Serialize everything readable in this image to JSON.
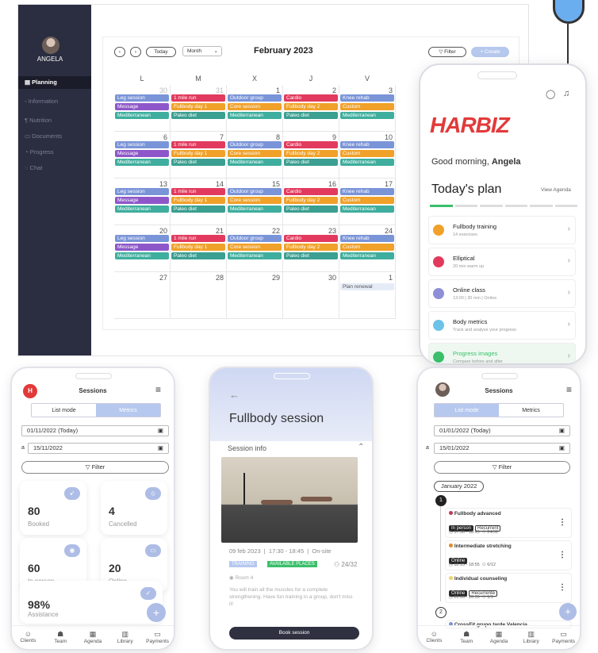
{
  "desktop": {
    "user": "ANGELA",
    "nav": [
      "Planning",
      "Information",
      "Nutrition",
      "Documents",
      "Progress",
      "Chat"
    ],
    "today": "Today",
    "view": "Month",
    "month": "February 2023",
    "filter": "Filter",
    "create": "+ Create",
    "days": [
      "L",
      "M",
      "X",
      "J",
      "V"
    ],
    "weeks": [
      {
        "dates": [
          "30",
          "31",
          "1",
          "2",
          "3"
        ],
        "muted": [
          true,
          true,
          false,
          false,
          false
        ]
      },
      {
        "dates": [
          "6",
          "7",
          "8",
          "9",
          "10"
        ]
      },
      {
        "dates": [
          "13",
          "14",
          "15",
          "16",
          "17"
        ]
      },
      {
        "dates": [
          "20",
          "21",
          "22",
          "23",
          "24"
        ]
      },
      {
        "dates": [
          "27",
          "28",
          "29",
          "30",
          "1"
        ]
      }
    ],
    "events": {
      "col0": [
        "Leg session",
        "Message",
        "Mediterranean"
      ],
      "col1": [
        "1 mile run",
        "Fullbody day 1",
        "Paleo diet"
      ],
      "col2": [
        "Outdoor group",
        "Core session",
        "Mediterranean"
      ],
      "col3": [
        "Cardio",
        "Fullbody day 2",
        "Paleo diet"
      ],
      "col4": [
        "Knee rehab",
        "Custom",
        "Mediterranean"
      ]
    },
    "plan_renewal": "Plan renewal"
  },
  "bigphone": {
    "logo": "HARBIZ",
    "greeting": "Good morning, ",
    "name": "Angela",
    "plan_title": "Today's plan",
    "view_agenda": "View Agenda",
    "items": [
      {
        "title": "Fullbody training",
        "sub": "14 exercises",
        "color": "#f0a129"
      },
      {
        "title": "Elliptical",
        "sub": "20 min warm up",
        "color": "#e23a5e"
      },
      {
        "title": "Online class",
        "sub": "13:00 | 30 min | Online",
        "color": "#8f8fd8"
      },
      {
        "title": "Body metrics",
        "sub": "Track and analyse your progress",
        "color": "#6cc3e8"
      },
      {
        "title": "Progress images",
        "sub": "Compare before and after",
        "color": "#3bbf6a"
      }
    ]
  },
  "phone1": {
    "title": "Sessions",
    "seg": [
      "List mode",
      "Metrics"
    ],
    "date_from": "01/11/2022 (Today)",
    "a": "a",
    "date_to": "15/11/2022",
    "filter": "Filter",
    "metrics": [
      {
        "value": "80",
        "label": "Booked"
      },
      {
        "value": "4",
        "label": "Cancelled"
      },
      {
        "value": "60",
        "label": "In person"
      },
      {
        "value": "20",
        "label": "Online"
      },
      {
        "value": "98%",
        "label": "Assistance"
      }
    ]
  },
  "phone2": {
    "title": "Fullbody session",
    "section": "Session info",
    "date": "09 feb 2023",
    "time": "17:30 - 18:45",
    "mode": "On-site",
    "tag1": "TRAINING",
    "tag2": "AVAILABLE PLACES",
    "places": "24/32",
    "room": "Room 4",
    "desc": "You will train all the muscles for a complete strengthening. Have fun training in a group, don't miss it!",
    "book": "Book session"
  },
  "phone3": {
    "title": "Sessions",
    "seg": [
      "List mode",
      "Metrics"
    ],
    "date_from": "01/01/2022 (Today)",
    "a": "a",
    "date_to": "15/01/2022",
    "filter": "Filter",
    "month": "January 2022",
    "sessions": [
      {
        "title": "Fullbody advanced",
        "tags": [
          "In person",
          "Recurrent"
        ],
        "time": "17:30 - 18:45",
        "places": "24/32",
        "color": "#c03a5a"
      },
      {
        "title": "Intermediate stretching",
        "tags": [
          "Online"
        ],
        "time": "18:15 - 18:55",
        "places": "6/12",
        "color": "#e08a2a"
      },
      {
        "title": "Individual counseling",
        "tags": [
          "Online",
          "Recurrente"
        ],
        "time": "20:00 - 20:35",
        "places": "1/1",
        "color": "#f2d36a"
      },
      {
        "title": "CrossFit grupo tarde Valencia",
        "tags": [],
        "time": "",
        "places": "",
        "color": "#7a94d8"
      }
    ]
  },
  "tabs": [
    "Clients",
    "Team",
    "Agenda",
    "Library",
    "Payments"
  ]
}
